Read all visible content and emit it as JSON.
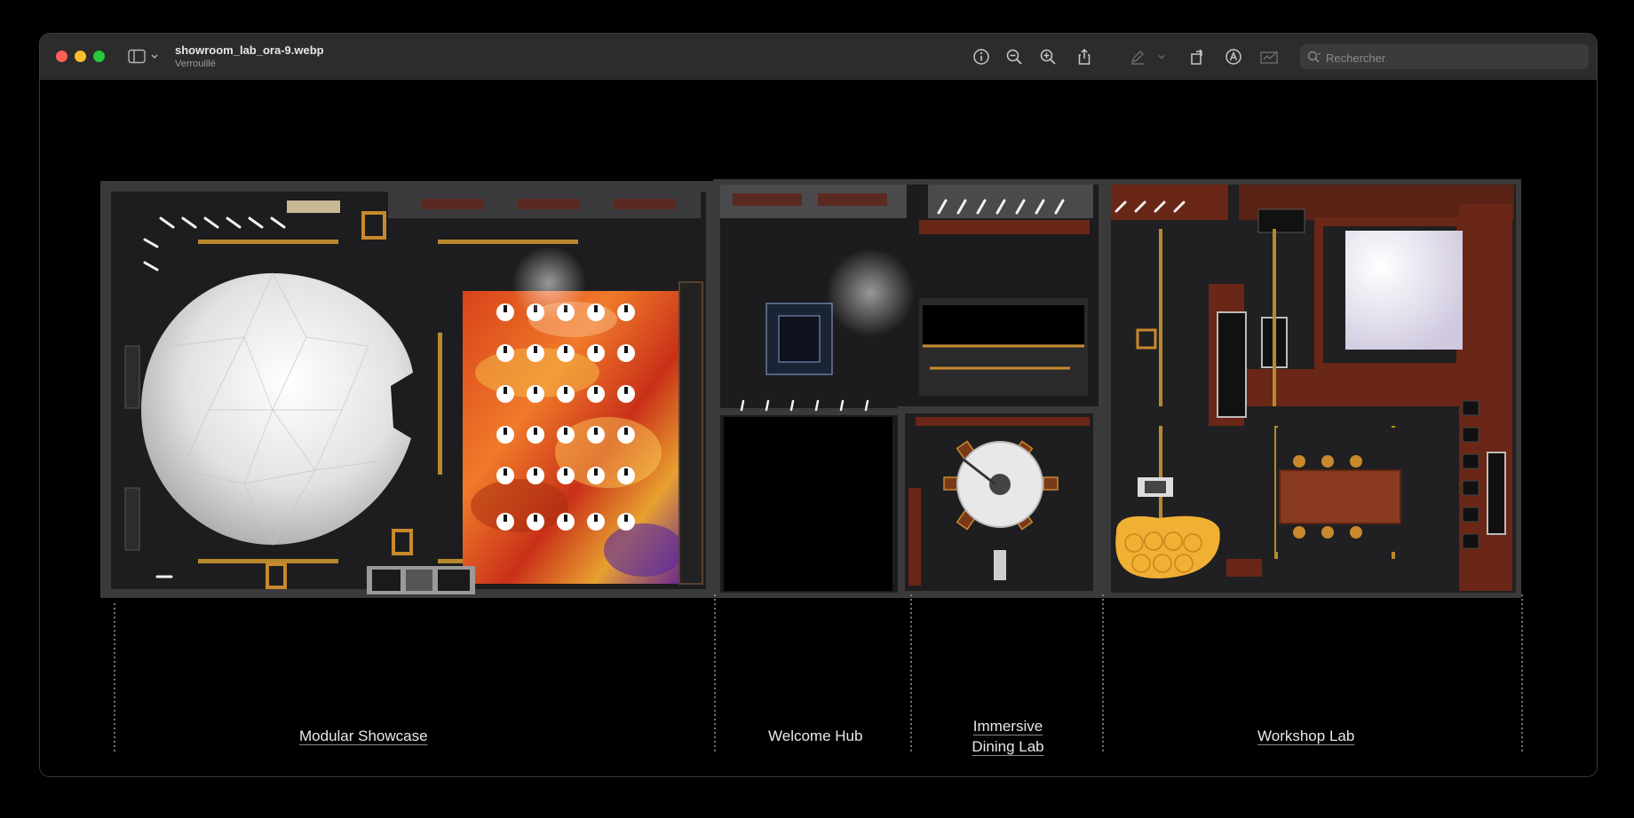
{
  "window": {
    "filename": "showroom_lab_ora-9.webp",
    "status": "Verrouillé"
  },
  "toolbar": {
    "icons": [
      "info-icon",
      "zoom-out-icon",
      "zoom-in-icon",
      "share-icon",
      "markup-pen-icon",
      "chevron-down-icon",
      "rotate-icon",
      "markup-a-icon",
      "signature-icon"
    ]
  },
  "search": {
    "placeholder": "Rechercher"
  },
  "zones": [
    {
      "label": "Modular Showcase"
    },
    {
      "label": "Welcome Hub"
    },
    {
      "label_line1": "Immersive",
      "label_line2": "Dining Lab"
    },
    {
      "label": "Workshop Lab"
    }
  ],
  "colors": {
    "toolbar_bg": "#2c2c2c",
    "close": "#ff5f57",
    "minimize": "#febc2e",
    "maximize": "#28c840",
    "wood": "#6a2616",
    "led_screen": "#e0521e"
  }
}
